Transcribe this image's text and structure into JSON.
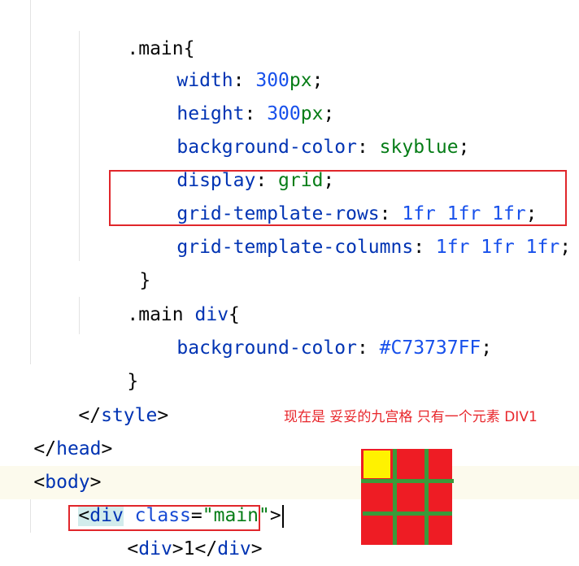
{
  "code": {
    "main_selector": ".main{",
    "width_prop": "width",
    "width_num": "300",
    "width_unit": "px",
    "height_prop": "height",
    "height_num": "300",
    "height_unit": "px",
    "bg_prop": "background-color",
    "bg_val": "skyblue",
    "display_prop": "display",
    "display_val": "grid",
    "rows_prop": "grid-template-rows",
    "rows_val": "1fr 1fr 1fr",
    "cols_prop": "grid-template-columns",
    "cols_val": "1fr 1fr 1fr",
    "close_brace": "}",
    "main_div_selector_a": ".main",
    "main_div_selector_b": "div",
    "main_div_brace": "{",
    "div_bg_prop": "background-color",
    "div_bg_val": "#C73737FF",
    "style_close_tag": "style",
    "head_close_tag": "head",
    "body_open_tag": "body",
    "div_tag": "div",
    "class_attr": "class",
    "class_val": "\"main\"",
    "inner_div_text": "1"
  },
  "annotation": {
    "note": "现在是 妥妥的九宫格 只有一个元素 DIV1"
  },
  "colors": {
    "annotation_red": "#e8262b",
    "grid_red": "#ee1c24",
    "grid_yellow": "#fff200",
    "grid_green": "#3a9a3a"
  }
}
